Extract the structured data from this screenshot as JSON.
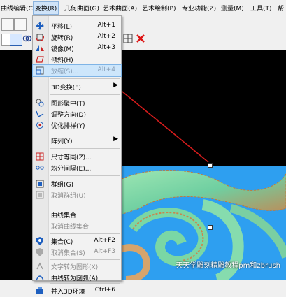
{
  "menubar": {
    "items": [
      {
        "label": "曲线编辑(C)"
      },
      {
        "label": "变换(R)"
      },
      {
        "label": "几何曲面(G)"
      },
      {
        "label": "艺术曲面(A)"
      },
      {
        "label": "艺术绘制(P)"
      },
      {
        "label": "专业功能(Z)"
      },
      {
        "label": "测量(M)"
      },
      {
        "label": "工具(T)"
      },
      {
        "label": "帮"
      }
    ]
  },
  "menu": {
    "items": [
      {
        "label": "平移(L)",
        "shortcut": "Alt+1",
        "icon": "move-icon"
      },
      {
        "label": "旋转(R)",
        "shortcut": "Alt+2",
        "icon": "rotate-icon"
      },
      {
        "label": "镜像(M)",
        "shortcut": "Alt+3",
        "icon": "mirror-icon"
      },
      {
        "label": "倾斜(H)",
        "shortcut": "",
        "icon": "skew-icon"
      },
      {
        "label": "放缩(S)...",
        "shortcut": "Alt+4",
        "icon": "scale-icon"
      },
      {
        "label": "3D变换(F)",
        "shortcut": "",
        "icon": ""
      },
      {
        "label": "图形聚中(T)",
        "shortcut": "",
        "icon": "center-icon"
      },
      {
        "label": "调整方向(D)",
        "shortcut": "",
        "icon": "direction-icon"
      },
      {
        "label": "优化排样(Y)",
        "shortcut": "",
        "icon": "nesting-icon"
      },
      {
        "label": "阵列(Y)",
        "shortcut": "",
        "icon": ""
      },
      {
        "label": "尺寸等同(Z)...",
        "shortcut": "",
        "icon": "same-size-icon"
      },
      {
        "label": "均分间隔(E)...",
        "shortcut": "",
        "icon": "spacing-icon"
      },
      {
        "label": "群组(G)",
        "shortcut": "",
        "icon": "group-icon"
      },
      {
        "label": "取消群组(U)",
        "shortcut": "",
        "icon": "ungroup-icon"
      },
      {
        "label": "曲线集合",
        "shortcut": "",
        "icon": ""
      },
      {
        "label": "取消曲线集合",
        "shortcut": "",
        "icon": ""
      },
      {
        "label": "集合(C)",
        "shortcut": "Alt+F2",
        "icon": "set-icon"
      },
      {
        "label": "取消集合(S)",
        "shortcut": "Alt+F3",
        "icon": "unset-icon"
      },
      {
        "label": "文字转为图形(X)",
        "shortcut": "",
        "icon": "text-to-shape-icon"
      },
      {
        "label": "曲线转为圆弧(A)",
        "shortcut": "",
        "icon": "curve-to-arc-icon"
      },
      {
        "label": "并入3D环境",
        "shortcut": "Ctrl+6",
        "icon": "merge-3d-icon"
      }
    ]
  },
  "watermark": {
    "text": "天天学雕刻精雕教程pm和zbrush"
  },
  "colors": {
    "highlight": "#cde6fb",
    "arrow": "#d41c1c",
    "canvas": "#000000",
    "render_bg": "#2e9ff0"
  }
}
